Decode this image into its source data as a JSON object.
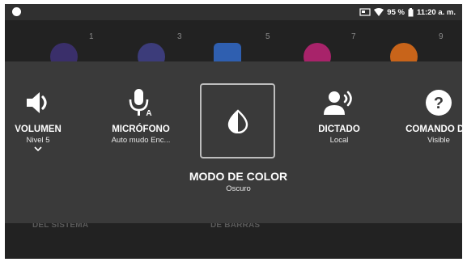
{
  "statusbar": {
    "battery": "95 %",
    "time": "11:20 a. m."
  },
  "background": {
    "page_numbers": [
      "1",
      "3",
      "5",
      "7",
      "9"
    ],
    "labels": [
      "DEL SISTEMA",
      "DE BARRAS"
    ],
    "app_colors": [
      "#3a2f6a",
      "#3c3c7a",
      "#2f5fb0",
      "#a8236a",
      "#c8641a"
    ]
  },
  "quick_settings": {
    "volume": {
      "title": "VOLUMEN",
      "subtitle": "Nivel 5",
      "icon": "volume-icon"
    },
    "microphone": {
      "title": "MICRÓFONO",
      "subtitle": "Auto mudo Enc...",
      "icon": "microphone-icon"
    },
    "color_mode": {
      "title": "MODO DE COLOR",
      "subtitle": "Oscuro",
      "icon": "contrast-icon"
    },
    "dictation": {
      "title": "DICTADO",
      "subtitle": "Local",
      "icon": "dictation-icon"
    },
    "command": {
      "title": "COMANDO D...",
      "subtitle": "Visible",
      "icon": "help-icon"
    }
  }
}
